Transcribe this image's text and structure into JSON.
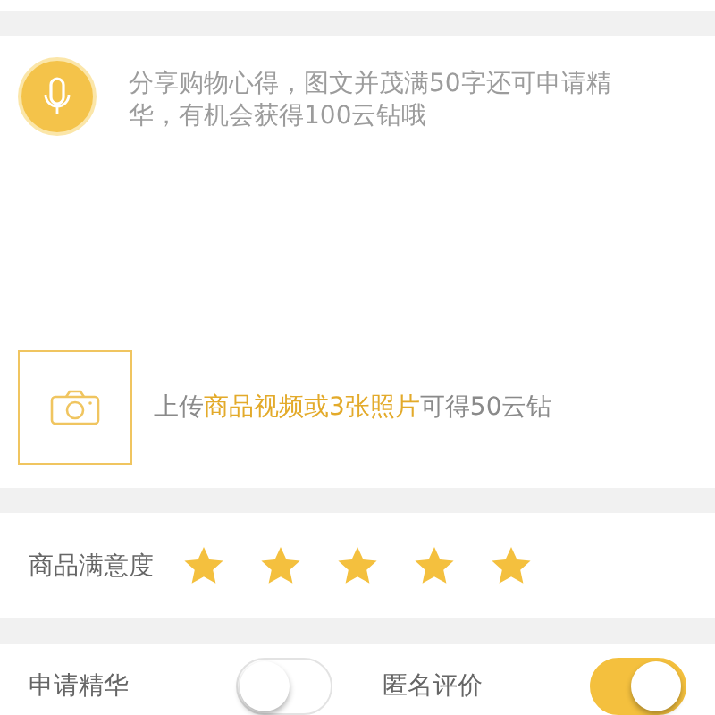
{
  "review": {
    "placeholder": "分享购物心得，图文并茂满50字还可申请精华，有机会获得100云钻哦"
  },
  "upload": {
    "hint": [
      {
        "text": "上传",
        "highlight": false
      },
      {
        "text": "商品视频或3张照片",
        "highlight": true
      },
      {
        "text": "可得50云钻",
        "highlight": false
      }
    ]
  },
  "rating": {
    "label": "商品满意度",
    "stars": 5
  },
  "options": [
    {
      "label": "申请精华",
      "on": false
    },
    {
      "label": "匿名评价",
      "on": true
    }
  ]
}
